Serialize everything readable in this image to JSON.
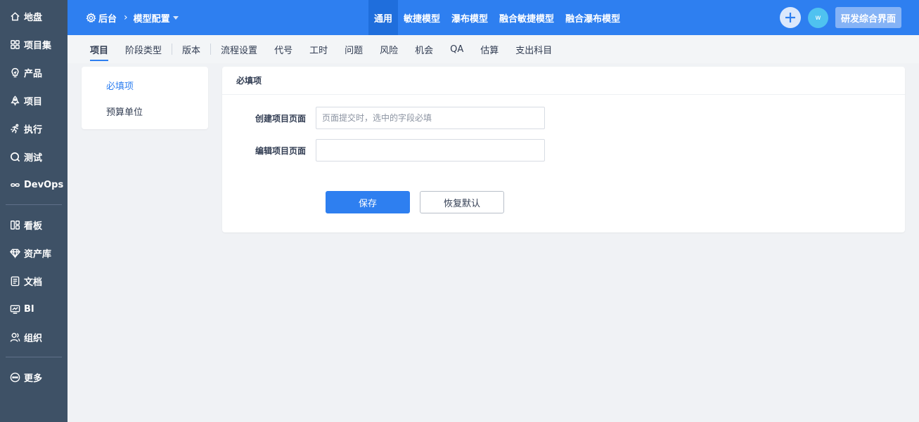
{
  "sidebar": {
    "items": [
      {
        "label": "地盘",
        "icon": "home-icon"
      },
      {
        "label": "项目集",
        "icon": "grid-icon"
      },
      {
        "label": "产品",
        "icon": "lightbulb-icon"
      },
      {
        "label": "项目",
        "icon": "flask-icon"
      },
      {
        "label": "执行",
        "icon": "run-icon"
      },
      {
        "label": "测试",
        "icon": "magnify-icon"
      },
      {
        "label": "DevOps",
        "icon": "infinity-icon"
      },
      {
        "label": "看板",
        "icon": "kanban-icon"
      },
      {
        "label": "资产库",
        "icon": "diamond-icon"
      },
      {
        "label": "文档",
        "icon": "document-icon"
      },
      {
        "label": "BI",
        "icon": "monitor-icon"
      },
      {
        "label": "组织",
        "icon": "users-icon"
      },
      {
        "label": "更多",
        "icon": "more-icon"
      }
    ]
  },
  "header": {
    "breadcrumb_root": "后台",
    "breadcrumb_current": "模型配置",
    "model_tabs": [
      {
        "label": "通用",
        "active": true
      },
      {
        "label": "敏捷模型",
        "active": false
      },
      {
        "label": "瀑布模型",
        "active": false
      },
      {
        "label": "融合敏捷模型",
        "active": false
      },
      {
        "label": "融合瀑布模型",
        "active": false
      }
    ],
    "avatar_initial": "w",
    "home_label": "研发综合界面"
  },
  "subnav": {
    "items": [
      {
        "label": "项目",
        "active": true
      },
      {
        "label": "阶段类型",
        "active": false
      },
      {
        "label": "版本",
        "active": false
      },
      {
        "label": "流程设置",
        "active": false
      },
      {
        "label": "代号",
        "active": false
      },
      {
        "label": "工时",
        "active": false
      },
      {
        "label": "问题",
        "active": false
      },
      {
        "label": "风险",
        "active": false
      },
      {
        "label": "机会",
        "active": false
      },
      {
        "label": "QA",
        "active": false
      },
      {
        "label": "估算",
        "active": false
      },
      {
        "label": "支出科目",
        "active": false
      }
    ]
  },
  "left_menu": {
    "items": [
      {
        "label": "必填项",
        "active": true
      },
      {
        "label": "预算单位",
        "active": false
      }
    ]
  },
  "main": {
    "title": "必填项",
    "fields": [
      {
        "label": "创建项目页面",
        "value": "",
        "placeholder": "页面提交时，选中的字段必填"
      },
      {
        "label": "编辑项目页面",
        "value": "",
        "placeholder": ""
      }
    ],
    "save_label": "保存",
    "reset_label": "恢复默认"
  },
  "colors": {
    "sidebar_bg": "#3e5166",
    "header_bg": "#2e7ff0",
    "accent": "#2e7ff0"
  }
}
